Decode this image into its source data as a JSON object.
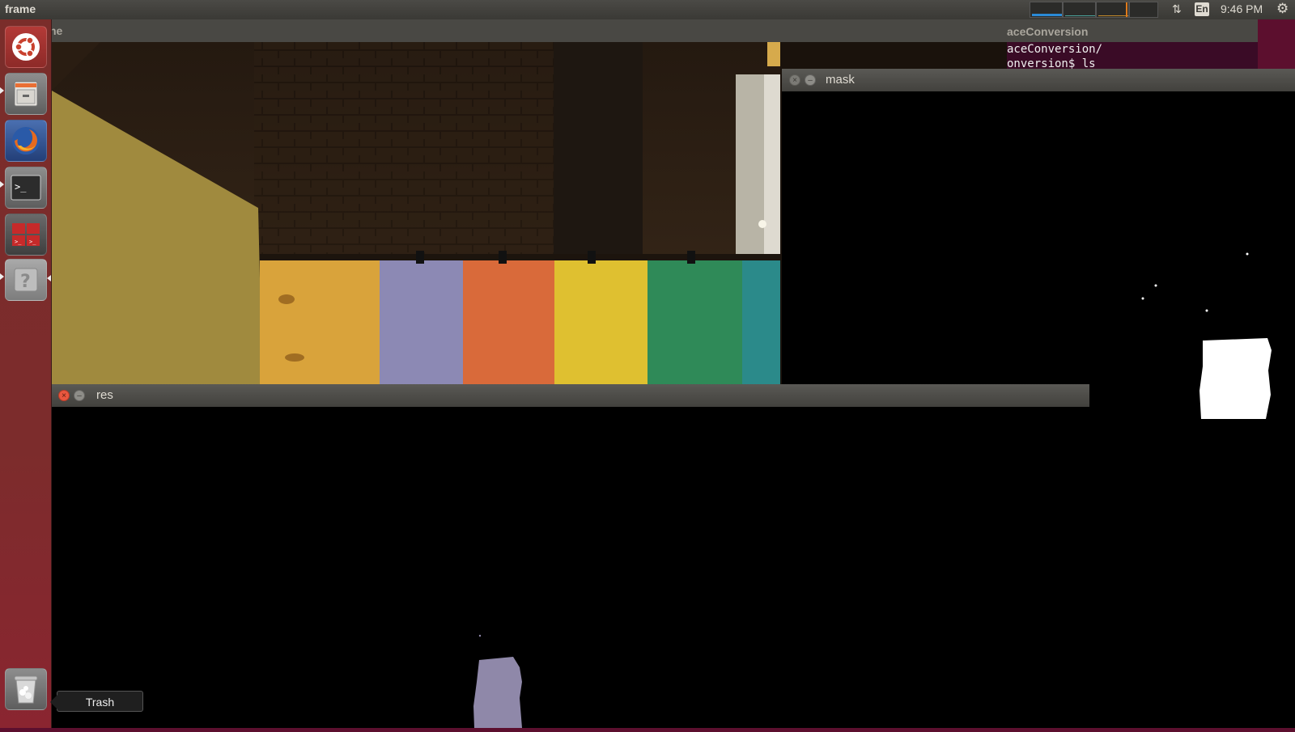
{
  "top_panel": {
    "app_title": "frame",
    "language": "En",
    "clock": "9:46 PM",
    "indicators": {
      "network": "network-transfer-icon",
      "settings": "gear-icon"
    }
  },
  "launcher": {
    "items": [
      {
        "name": "ubuntu-dash",
        "icon": "ubuntu-logo-icon"
      },
      {
        "name": "files",
        "icon": "file-cabinet-icon"
      },
      {
        "name": "firefox",
        "icon": "firefox-icon"
      },
      {
        "name": "terminal",
        "icon": "terminal-icon"
      },
      {
        "name": "workspaces",
        "icon": "workspace-switcher-icon"
      },
      {
        "name": "help",
        "icon": "question-mark-icon"
      }
    ],
    "trash": {
      "icon": "trash-icon",
      "tooltip": "Trash"
    }
  },
  "windows": {
    "frame": {
      "title_fragment": "ne"
    },
    "terminal": {
      "title_fragment": "aceConversion",
      "lines": [
        "aceConversion/",
        "onversion$ ls"
      ]
    },
    "mask": {
      "title": "mask"
    },
    "res": {
      "title": "res"
    }
  },
  "colors": {
    "panel": "#3a3935",
    "launcher": "#7c2c2c",
    "close_button": "#e9573f",
    "desktop": "#5c0f2e",
    "terminal_bg": "#3a0b26"
  }
}
